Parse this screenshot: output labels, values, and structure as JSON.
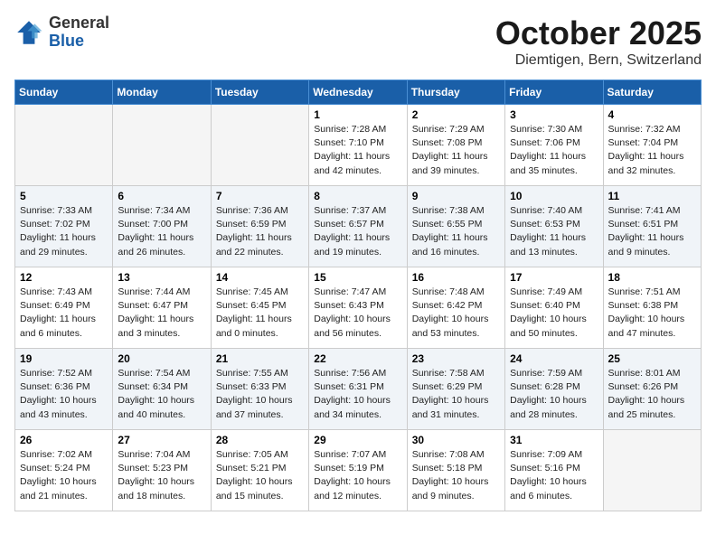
{
  "header": {
    "logo_general": "General",
    "logo_blue": "Blue",
    "month_title": "October 2025",
    "location": "Diemtigen, Bern, Switzerland"
  },
  "weekdays": [
    "Sunday",
    "Monday",
    "Tuesday",
    "Wednesday",
    "Thursday",
    "Friday",
    "Saturday"
  ],
  "weeks": [
    [
      {
        "day": "",
        "info": ""
      },
      {
        "day": "",
        "info": ""
      },
      {
        "day": "",
        "info": ""
      },
      {
        "day": "1",
        "info": "Sunrise: 7:28 AM\nSunset: 7:10 PM\nDaylight: 11 hours\nand 42 minutes."
      },
      {
        "day": "2",
        "info": "Sunrise: 7:29 AM\nSunset: 7:08 PM\nDaylight: 11 hours\nand 39 minutes."
      },
      {
        "day": "3",
        "info": "Sunrise: 7:30 AM\nSunset: 7:06 PM\nDaylight: 11 hours\nand 35 minutes."
      },
      {
        "day": "4",
        "info": "Sunrise: 7:32 AM\nSunset: 7:04 PM\nDaylight: 11 hours\nand 32 minutes."
      }
    ],
    [
      {
        "day": "5",
        "info": "Sunrise: 7:33 AM\nSunset: 7:02 PM\nDaylight: 11 hours\nand 29 minutes."
      },
      {
        "day": "6",
        "info": "Sunrise: 7:34 AM\nSunset: 7:00 PM\nDaylight: 11 hours\nand 26 minutes."
      },
      {
        "day": "7",
        "info": "Sunrise: 7:36 AM\nSunset: 6:59 PM\nDaylight: 11 hours\nand 22 minutes."
      },
      {
        "day": "8",
        "info": "Sunrise: 7:37 AM\nSunset: 6:57 PM\nDaylight: 11 hours\nand 19 minutes."
      },
      {
        "day": "9",
        "info": "Sunrise: 7:38 AM\nSunset: 6:55 PM\nDaylight: 11 hours\nand 16 minutes."
      },
      {
        "day": "10",
        "info": "Sunrise: 7:40 AM\nSunset: 6:53 PM\nDaylight: 11 hours\nand 13 minutes."
      },
      {
        "day": "11",
        "info": "Sunrise: 7:41 AM\nSunset: 6:51 PM\nDaylight: 11 hours\nand 9 minutes."
      }
    ],
    [
      {
        "day": "12",
        "info": "Sunrise: 7:43 AM\nSunset: 6:49 PM\nDaylight: 11 hours\nand 6 minutes."
      },
      {
        "day": "13",
        "info": "Sunrise: 7:44 AM\nSunset: 6:47 PM\nDaylight: 11 hours\nand 3 minutes."
      },
      {
        "day": "14",
        "info": "Sunrise: 7:45 AM\nSunset: 6:45 PM\nDaylight: 11 hours\nand 0 minutes."
      },
      {
        "day": "15",
        "info": "Sunrise: 7:47 AM\nSunset: 6:43 PM\nDaylight: 10 hours\nand 56 minutes."
      },
      {
        "day": "16",
        "info": "Sunrise: 7:48 AM\nSunset: 6:42 PM\nDaylight: 10 hours\nand 53 minutes."
      },
      {
        "day": "17",
        "info": "Sunrise: 7:49 AM\nSunset: 6:40 PM\nDaylight: 10 hours\nand 50 minutes."
      },
      {
        "day": "18",
        "info": "Sunrise: 7:51 AM\nSunset: 6:38 PM\nDaylight: 10 hours\nand 47 minutes."
      }
    ],
    [
      {
        "day": "19",
        "info": "Sunrise: 7:52 AM\nSunset: 6:36 PM\nDaylight: 10 hours\nand 43 minutes."
      },
      {
        "day": "20",
        "info": "Sunrise: 7:54 AM\nSunset: 6:34 PM\nDaylight: 10 hours\nand 40 minutes."
      },
      {
        "day": "21",
        "info": "Sunrise: 7:55 AM\nSunset: 6:33 PM\nDaylight: 10 hours\nand 37 minutes."
      },
      {
        "day": "22",
        "info": "Sunrise: 7:56 AM\nSunset: 6:31 PM\nDaylight: 10 hours\nand 34 minutes."
      },
      {
        "day": "23",
        "info": "Sunrise: 7:58 AM\nSunset: 6:29 PM\nDaylight: 10 hours\nand 31 minutes."
      },
      {
        "day": "24",
        "info": "Sunrise: 7:59 AM\nSunset: 6:28 PM\nDaylight: 10 hours\nand 28 minutes."
      },
      {
        "day": "25",
        "info": "Sunrise: 8:01 AM\nSunset: 6:26 PM\nDaylight: 10 hours\nand 25 minutes."
      }
    ],
    [
      {
        "day": "26",
        "info": "Sunrise: 7:02 AM\nSunset: 5:24 PM\nDaylight: 10 hours\nand 21 minutes."
      },
      {
        "day": "27",
        "info": "Sunrise: 7:04 AM\nSunset: 5:23 PM\nDaylight: 10 hours\nand 18 minutes."
      },
      {
        "day": "28",
        "info": "Sunrise: 7:05 AM\nSunset: 5:21 PM\nDaylight: 10 hours\nand 15 minutes."
      },
      {
        "day": "29",
        "info": "Sunrise: 7:07 AM\nSunset: 5:19 PM\nDaylight: 10 hours\nand 12 minutes."
      },
      {
        "day": "30",
        "info": "Sunrise: 7:08 AM\nSunset: 5:18 PM\nDaylight: 10 hours\nand 9 minutes."
      },
      {
        "day": "31",
        "info": "Sunrise: 7:09 AM\nSunset: 5:16 PM\nDaylight: 10 hours\nand 6 minutes."
      },
      {
        "day": "",
        "info": ""
      }
    ]
  ]
}
